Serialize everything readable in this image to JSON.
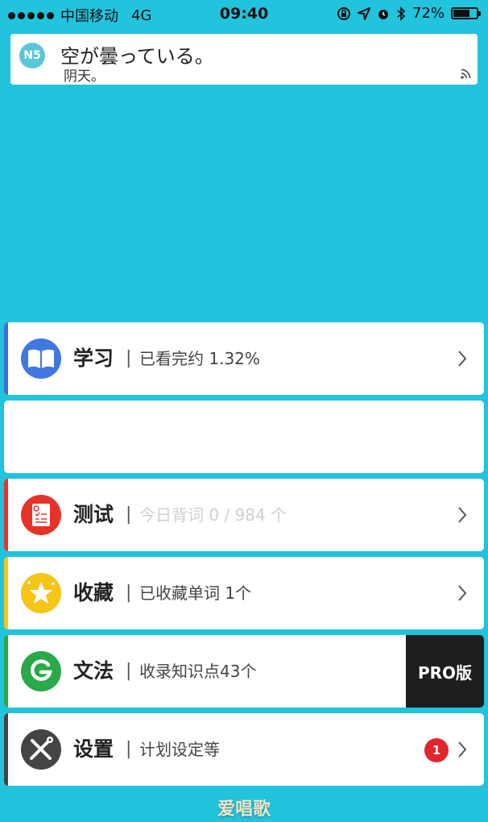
{
  "status_bar": {
    "carrier": "中国移动",
    "network": "4G",
    "time": "09:40",
    "battery": "72%",
    "battery_level": 0.72,
    "icons": [
      "signal-dots-icon",
      "screen-rotation-lock-icon",
      "location-arrow-icon",
      "alarm-icon",
      "bluetooth-icon",
      "battery-icon"
    ]
  },
  "notification": {
    "app_badge": "N5",
    "title": "空が曇っている。",
    "subtitle": "阴天。"
  },
  "menu": [
    {
      "key": "study",
      "label": "学习",
      "separator": "|",
      "description": "已看完约 1.32%",
      "accent": "#3a6fd8",
      "icon": "book-icon"
    },
    {
      "key": "blank",
      "label": "",
      "description": ""
    },
    {
      "key": "test",
      "label": "测试",
      "separator": "|",
      "description": "今日背词 0 / 984 个",
      "accent": "#e5332a",
      "icon": "test-paper-icon"
    },
    {
      "key": "favorites",
      "label": "收藏",
      "separator": "|",
      "description": "已收藏单词 1个",
      "accent": "#f5c518",
      "icon": "star-icon"
    },
    {
      "key": "grammar",
      "label": "文法",
      "separator": "|",
      "description": "收录知识点43个",
      "accent": "#2aa84a",
      "icon": "grammar-g-icon",
      "pro_label": "PRO版"
    },
    {
      "key": "settings",
      "label": "设置",
      "separator": "|",
      "description": "计划设定等",
      "accent": "#444444",
      "icon": "tools-icon",
      "badge": "1"
    }
  ],
  "watermark": "爱唱歌",
  "colors": {
    "background": "#22c3dc",
    "badge_red": "#e3262d",
    "pro_bg": "#1e1e1e"
  }
}
